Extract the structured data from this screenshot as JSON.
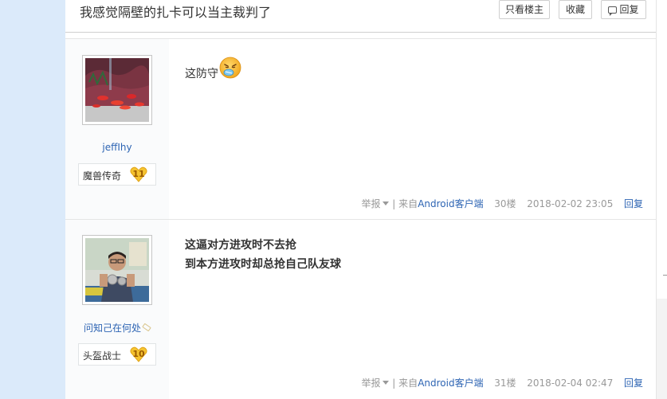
{
  "thread": {
    "title": "我感觉隔壁的扎卡可以当主裁判了",
    "only_op_label": "只看楼主",
    "collect_label": "收藏",
    "reply_label": "回复"
  },
  "posts": [
    {
      "username": "jeffIhy",
      "level_name": "魔兽传奇",
      "level_num": "11",
      "content_lines": [
        "这防守"
      ],
      "emoji": "sneeze-face-icon",
      "report": "举报",
      "source_prefix": "来自",
      "source_link": "Android客户端",
      "floor": "30楼",
      "time": "2018-02-02 23:05",
      "reply": "回复"
    },
    {
      "username": "问知己在何处",
      "level_name": "头盔战士",
      "level_num": "10",
      "content_lines": [
        "这逼对方进攻时不去抢",
        "到本方进攻时却总抢自己队友球"
      ],
      "report": "举报",
      "source_prefix": "来自",
      "source_link": "Android客户端",
      "floor": "31楼",
      "time": "2018-02-04 02:47",
      "reply": "回复"
    }
  ],
  "colors": {
    "link": "#2d64b3",
    "badge": "#f5c330",
    "left_strip": "#dbeafa"
  }
}
